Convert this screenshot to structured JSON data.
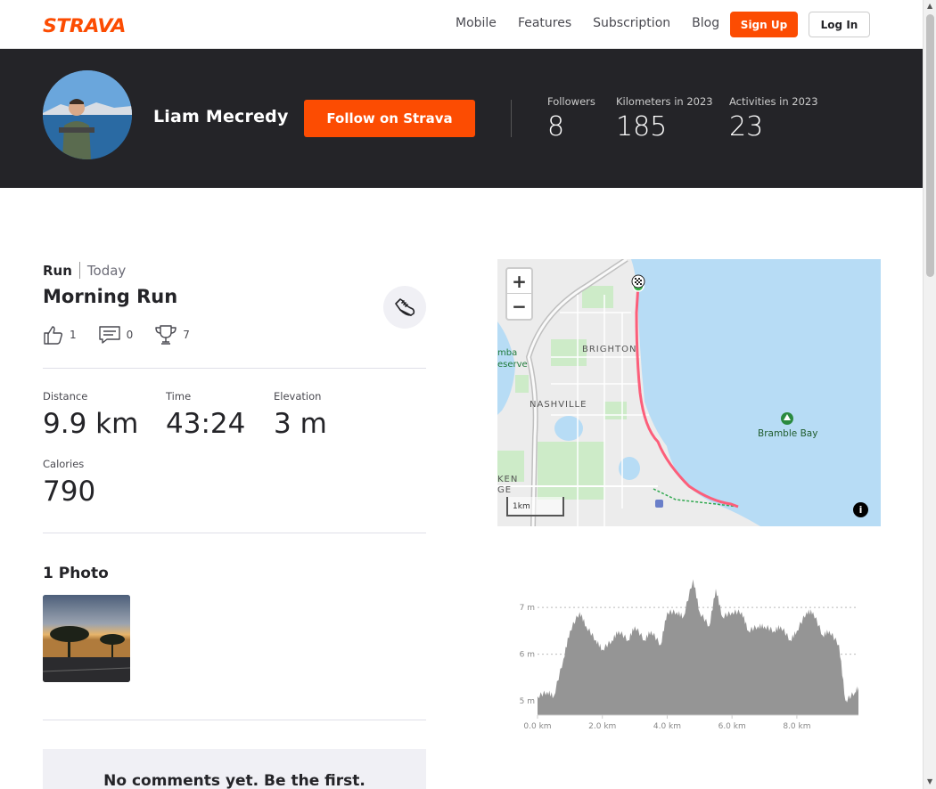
{
  "nav": {
    "logo": "STRAVA",
    "links": [
      "Mobile",
      "Features",
      "Subscription",
      "Blog"
    ],
    "signup": "Sign Up",
    "login": "Log In"
  },
  "athlete": {
    "name": "Liam Mecredy",
    "follow_label": "Follow on Strava",
    "stats": [
      {
        "label": "Followers",
        "value": "8"
      },
      {
        "label": "Kilometers in 2023",
        "value": "185"
      },
      {
        "label": "Activities in 2023",
        "value": "23"
      }
    ]
  },
  "activity": {
    "type": "Run",
    "date": "Today",
    "title": "Morning Run",
    "kudos": "1",
    "comments": "0",
    "achievements": "7",
    "metrics": [
      {
        "label": "Distance",
        "value": "9.9 km"
      },
      {
        "label": "Time",
        "value": "43:24"
      },
      {
        "label": "Elevation",
        "value": "3 m"
      },
      {
        "label": "Calories",
        "value": "790"
      }
    ]
  },
  "photos": {
    "title": "1 Photo"
  },
  "comments": {
    "empty_text": "No comments yet. Be the first."
  },
  "map": {
    "zoom_in": "+",
    "zoom_out": "−",
    "scale_label": "1km",
    "info": "i",
    "labels": [
      "BRIGHTON",
      "NASHVILLE",
      "Bramble Bay",
      "mba",
      "eserve",
      "KEN",
      "GE"
    ],
    "water_color": "#b7dcf5",
    "route_color": "#fc5e7a"
  },
  "elevation": {
    "y_ticks": [
      "7 m",
      "6 m",
      "5 m"
    ],
    "x_ticks": [
      "0.0 km",
      "2.0 km",
      "4.0 km",
      "6.0 km",
      "8.0 km"
    ]
  },
  "chart_data": {
    "type": "area",
    "title": "",
    "xlabel": "",
    "ylabel": "",
    "x": [
      0.0,
      0.3,
      0.5,
      0.8,
      1.0,
      1.3,
      1.5,
      1.8,
      2.0,
      2.3,
      2.5,
      2.8,
      3.0,
      3.3,
      3.5,
      3.8,
      4.0,
      4.3,
      4.5,
      4.8,
      5.0,
      5.3,
      5.5,
      5.7,
      6.0,
      6.3,
      6.5,
      6.8,
      7.0,
      7.3,
      7.5,
      7.8,
      8.0,
      8.3,
      8.5,
      8.8,
      9.0,
      9.3,
      9.5,
      9.8,
      9.9
    ],
    "y": [
      5.1,
      5.2,
      5.1,
      5.9,
      6.5,
      6.9,
      6.6,
      6.3,
      6.1,
      6.3,
      6.5,
      6.3,
      6.6,
      6.3,
      6.5,
      6.2,
      6.9,
      6.9,
      6.8,
      7.6,
      6.9,
      6.6,
      7.4,
      6.8,
      6.9,
      6.9,
      6.5,
      6.6,
      6.6,
      6.5,
      6.6,
      6.3,
      6.5,
      6.9,
      6.9,
      6.4,
      6.5,
      6.2,
      5.0,
      5.2,
      5.3
    ],
    "ylim": [
      4.7,
      7.8
    ],
    "xlim": [
      0,
      9.9
    ],
    "grid": true
  }
}
